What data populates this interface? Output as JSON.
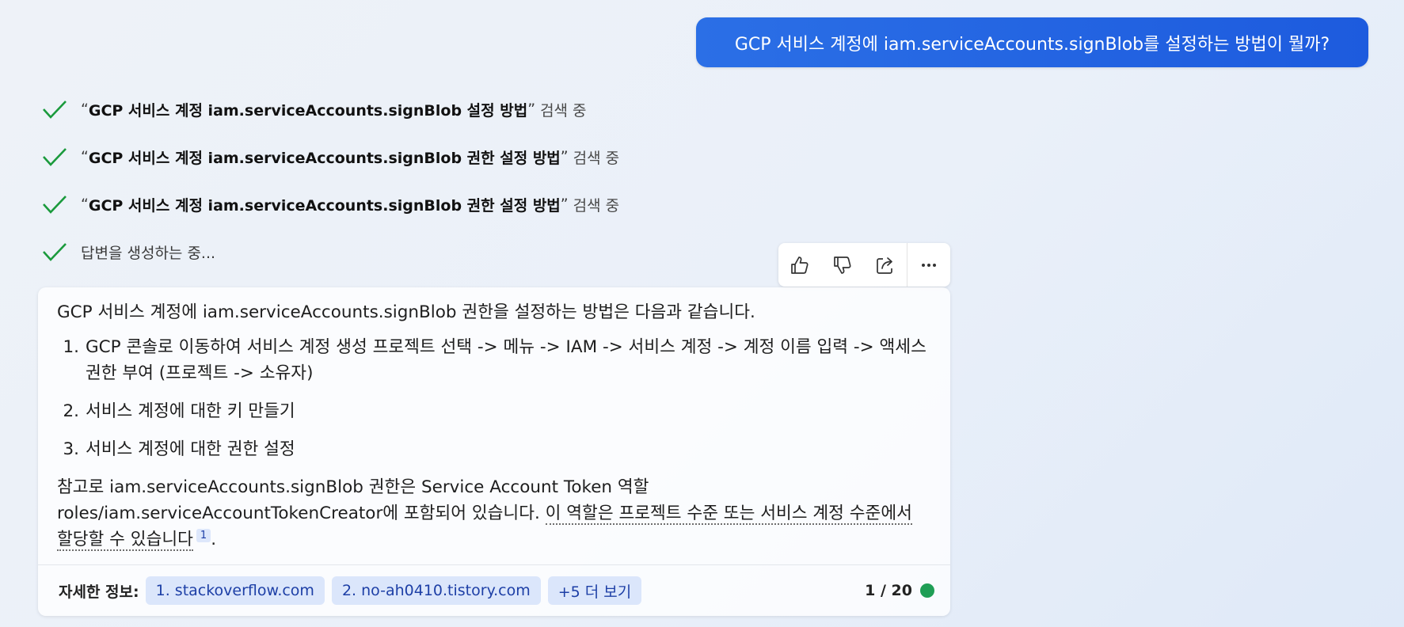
{
  "user_message": "GCP 서비스 계정에 iam.serviceAccounts.signBlob를 설정하는 방법이 뭘까?",
  "steps": [
    {
      "prefix": "“",
      "query": "GCP 서비스 계정 iam.serviceAccounts.signBlob 설정 방법",
      "close": "”",
      "suffix": "검색 중"
    },
    {
      "prefix": "“",
      "query": "GCP 서비스 계정 iam.serviceAccounts.signBlob 권한 설정 방법",
      "close": "”",
      "suffix": "검색 중"
    },
    {
      "prefix": "“",
      "query": "GCP 서비스 계정 iam.serviceAccounts.signBlob 권한 설정 방법",
      "close": "”",
      "suffix": "검색 중"
    },
    {
      "text": "답변을 생성하는 중..."
    }
  ],
  "toolbar": {
    "icons": [
      "thumbs-up-icon",
      "thumbs-down-icon",
      "share-icon",
      "more-icon"
    ]
  },
  "answer": {
    "intro": "GCP 서비스 계정에 iam.serviceAccounts.signBlob 권한을 설정하는 방법은 다음과 같습니다.",
    "list": [
      {
        "num": "1.",
        "text": "GCP 콘솔로 이동하여 서비스 계정 생성 프로젝트 선택 -> 메뉴 -> IAM -> 서비스 계정 -> 계정 이름 입력 -> 액세스 권한 부여 (프로젝트 -> 소유자)"
      },
      {
        "num": "2.",
        "text": "서비스 계정에 대한 키 만들기"
      },
      {
        "num": "3.",
        "text": "서비스 계정에 대한 권한 설정"
      }
    ],
    "note_plain": "참고로 iam.serviceAccounts.signBlob 권한은 Service Account Token 역할 roles/iam.serviceAccountTokenCreator에 포함되어 있습니다. ",
    "note_cited": "이 역할은 프로젝트 수준 또는 서비스 계정 수준에서 할당할 수 있습니다",
    "citation": "1",
    "note_end": "."
  },
  "footer": {
    "label": "자세한 정보:",
    "links": [
      "1. stackoverflow.com",
      "2. no-ah0410.tistory.com",
      "+5 더 보기"
    ],
    "counter": "1 / 20",
    "status_color": "#1f9e55"
  }
}
